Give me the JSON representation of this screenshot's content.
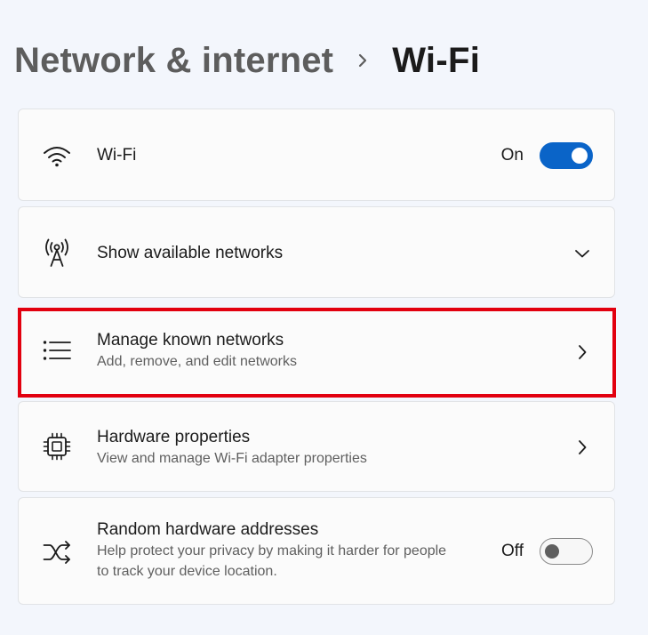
{
  "breadcrumb": {
    "parent": "Network & internet",
    "separator_icon": "chevron-right-icon",
    "current": "Wi-Fi"
  },
  "colors": {
    "accent": "#0a64c8",
    "highlight": "#e2000f",
    "background": "#f3f6fc",
    "card": "#fbfbfb"
  },
  "settings": {
    "wifi": {
      "icon": "wifi-icon",
      "title": "Wi-Fi",
      "toggle_label": "On",
      "toggle_on": true
    },
    "available_networks": {
      "icon": "antenna-icon",
      "title": "Show available networks",
      "action_icon": "chevron-down-icon"
    },
    "known_networks": {
      "icon": "list-icon",
      "title": "Manage known networks",
      "description": "Add, remove, and edit networks",
      "action_icon": "chevron-right-icon",
      "highlighted": true
    },
    "hardware": {
      "icon": "chip-icon",
      "title": "Hardware properties",
      "description": "View and manage Wi-Fi adapter properties",
      "action_icon": "chevron-right-icon"
    },
    "random_addresses": {
      "icon": "shuffle-icon",
      "title": "Random hardware addresses",
      "description": "Help protect your privacy by making it harder for people to track your device location.",
      "toggle_label": "Off",
      "toggle_on": false
    }
  }
}
